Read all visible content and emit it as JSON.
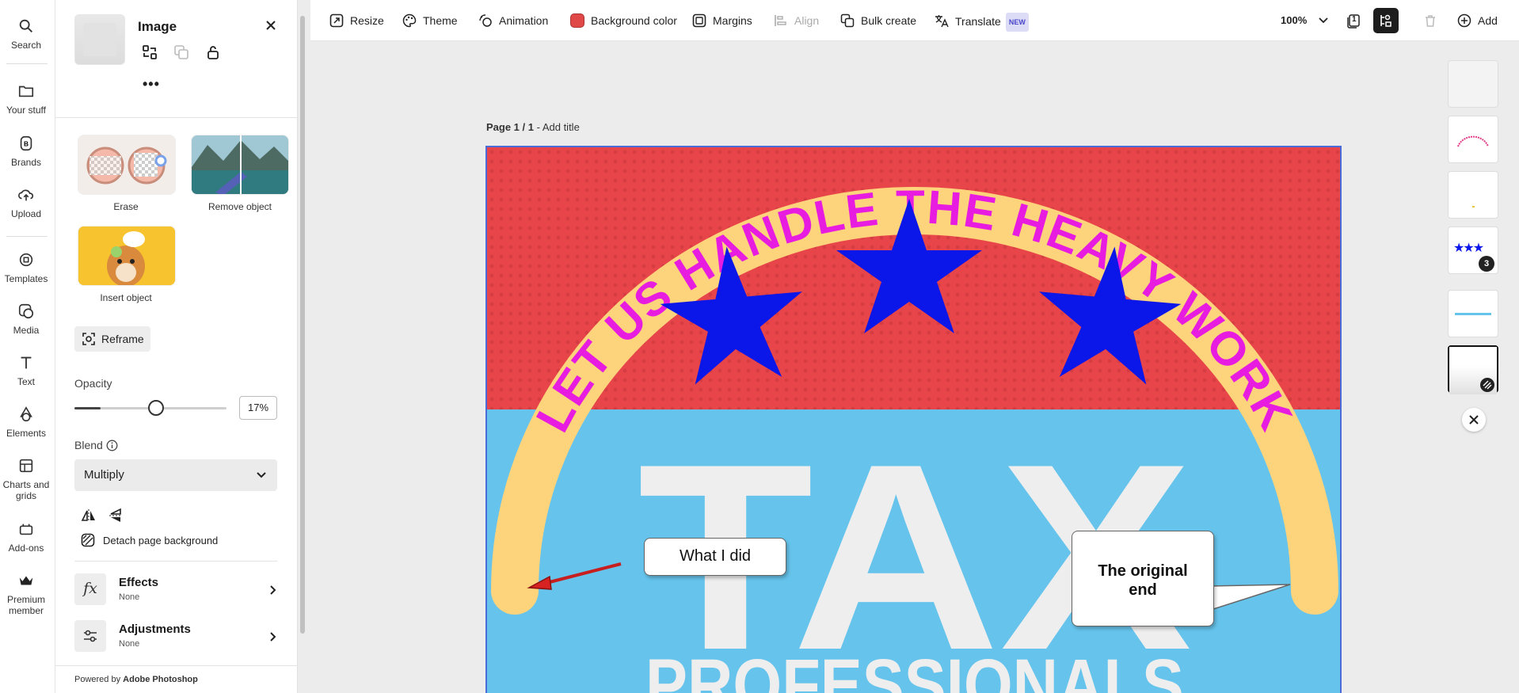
{
  "rail": {
    "items": [
      {
        "label": "Search"
      },
      {
        "label": "Your stuff"
      },
      {
        "label": "Brands"
      },
      {
        "label": "Upload"
      },
      {
        "label": "Templates"
      },
      {
        "label": "Media"
      },
      {
        "label": "Text"
      },
      {
        "label": "Elements"
      },
      {
        "label": "Charts and grids"
      },
      {
        "label": "Add-ons"
      },
      {
        "label": "Premium member"
      }
    ]
  },
  "panel": {
    "title": "Image",
    "more_label": "•••",
    "ai_tools": [
      {
        "label": "Erase"
      },
      {
        "label": "Remove object"
      },
      {
        "label": "Insert object"
      }
    ],
    "reframe_label": "Reframe",
    "opacity": {
      "label": "Opacity",
      "value_text": "17%",
      "value": 0.17
    },
    "blend": {
      "label": "Blend",
      "selected": "Multiply"
    },
    "detach_label": "Detach page background",
    "effects": {
      "title": "Effects",
      "value": "None"
    },
    "adjustments": {
      "title": "Adjustments",
      "value": "None"
    },
    "powered_prefix": "Powered by ",
    "powered_brand": "Adobe Photoshop"
  },
  "toolbar": {
    "resize": "Resize",
    "theme": "Theme",
    "animation": "Animation",
    "background_color": "Background color",
    "background_swatch": "#e04848",
    "margins": "Margins",
    "align": "Align",
    "bulk_create": "Bulk create",
    "translate": "Translate",
    "new_badge": "NEW",
    "zoom": "100%",
    "page_count": "1",
    "add": "Add"
  },
  "canvas": {
    "page_label": "Page 1 / 1",
    "page_label_sep": " - ",
    "page_title_placeholder": "Add title",
    "arc_text": "LET US HANDLE THE HEAVY WORK",
    "big_text": "TAX",
    "sub_text": "PROFESSIONALS",
    "callout_left": "What I did",
    "callout_right_line1": "The original",
    "callout_right_line2": "end",
    "colors": {
      "top_bg": "#e8454a",
      "bottom_bg": "#66c4ec",
      "arc_band": "#fdd37c",
      "arc_text": "#e81ce0",
      "stars": "#0b16e8",
      "big_text": "#eeeeee"
    }
  },
  "pages_strip": {
    "badge_count": "3"
  }
}
